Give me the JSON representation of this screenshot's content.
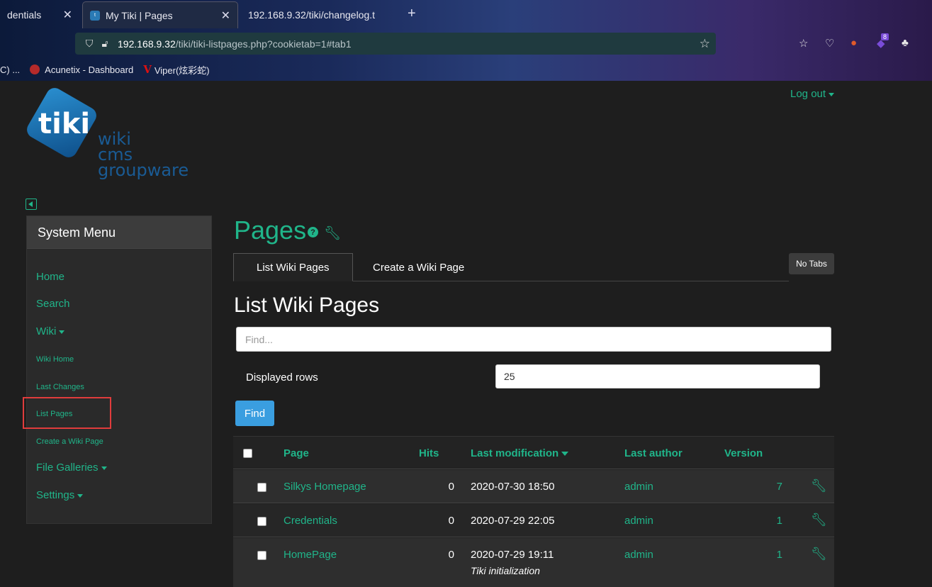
{
  "browser": {
    "tabs": [
      {
        "label": "dentials"
      },
      {
        "label": "My Tiki | Pages"
      },
      {
        "label": "192.168.9.32/tiki/changelog.t"
      }
    ],
    "url_host": "192.168.9.32",
    "url_path": "/tiki/tiki-listpages.php?cookietab=1#tab1",
    "bookmarks": [
      "C) ...",
      "Acunetix - Dashboard",
      "Viper(炫彩蛇)"
    ],
    "extension_badge": "8"
  },
  "header": {
    "logout_label": "Log out",
    "logo_text": "tiki",
    "logo_tagline": [
      "wiki",
      "cms",
      "groupware"
    ]
  },
  "sidebar": {
    "title": "System Menu",
    "items": [
      {
        "label": "Home"
      },
      {
        "label": "Search"
      },
      {
        "label": "Wiki"
      },
      {
        "label": "Wiki Home"
      },
      {
        "label": "Last Changes"
      },
      {
        "label": "List Pages"
      },
      {
        "label": "Create a Wiki Page"
      },
      {
        "label": "File Galleries"
      },
      {
        "label": "Settings"
      }
    ]
  },
  "main": {
    "title": "Pages",
    "tabs": [
      {
        "label": "List Wiki Pages"
      },
      {
        "label": "Create a Wiki Page"
      }
    ],
    "no_tabs_label": "No Tabs",
    "section_title": "List Wiki Pages",
    "find_placeholder": "Find...",
    "rows_label": "Displayed rows",
    "rows_value": "25",
    "find_button": "Find",
    "table": {
      "columns": [
        "Page",
        "Hits",
        "Last modification",
        "Last author",
        "Version"
      ],
      "rows": [
        {
          "page": "Silkys Homepage",
          "hits": "0",
          "modified": "2020-07-30 18:50",
          "author": "admin",
          "version": "7",
          "comment": ""
        },
        {
          "page": "Credentials",
          "hits": "0",
          "modified": "2020-07-29 22:05",
          "author": "admin",
          "version": "1",
          "comment": ""
        },
        {
          "page": "HomePage",
          "hits": "0",
          "modified": "2020-07-29 19:11",
          "author": "admin",
          "version": "1",
          "comment": "Tiki initialization"
        }
      ]
    }
  }
}
